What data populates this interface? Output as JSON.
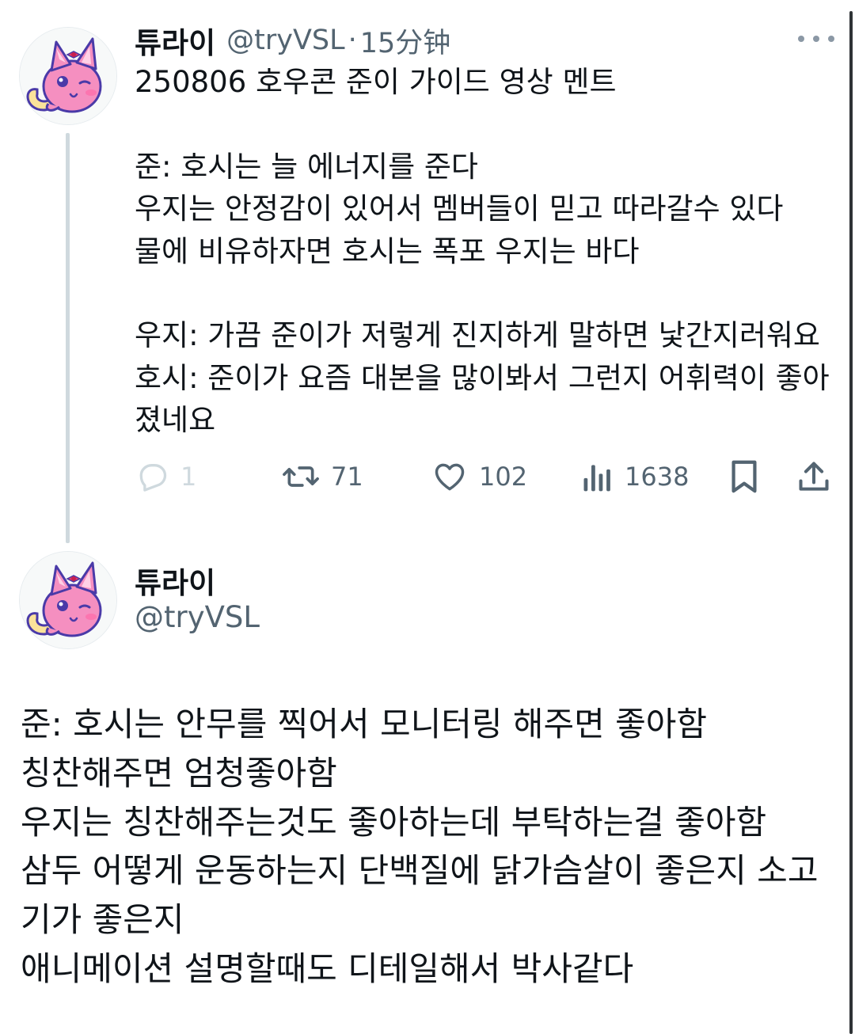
{
  "colors": {
    "text": "#0f1419",
    "secondary": "#536471",
    "thread_line": "#cfd9de",
    "avatar_pink": "#f58fc0",
    "avatar_outline": "#4a3aa8",
    "avatar_tail": "#fbe39a"
  },
  "tweet1": {
    "author_name": "튜라이",
    "handle": "@tryVSL",
    "separator": "·",
    "time": "15分钟",
    "more_icon": "more-horizontal-icon",
    "text": "250806 호우콘 준이 가이드 영상 멘트\n\n준: 호시는 늘 에너지를 준다\n우지는 안정감이 있어서 멤버들이 믿고 따라갈수 있다\n물에 비유하자면 호시는 폭포 우지는 바다\n\n우지: 가끔 준이가 저렇게 진지하게 말하면 낯간지러워요\n호시:  준이가 요즘 대본을 많이봐서 그런지 어휘력이 좋아졌네요",
    "actions": {
      "reply": {
        "icon": "reply-icon",
        "count": "1"
      },
      "retweet": {
        "icon": "retweet-icon",
        "count": "71"
      },
      "like": {
        "icon": "heart-icon",
        "count": "102"
      },
      "views": {
        "icon": "views-bar-chart-icon",
        "count": "1638"
      },
      "bookmark": {
        "icon": "bookmark-icon"
      },
      "share": {
        "icon": "share-icon"
      }
    }
  },
  "tweet2": {
    "author_name": "튜라이",
    "handle": "@tryVSL",
    "text": "준: 호시는 안무를 찍어서 모니터링 해주면 좋아함\n칭찬해주면 엄청좋아함\n우지는 칭찬해주는것도 좋아하는데 부탁하는걸 좋아함\n삼두 어떻게 운동하는지 단백질에 닭가슴살이 좋은지 소고기가 좋은지\n애니메이션 설명할때도 디테일해서 박사같다"
  }
}
